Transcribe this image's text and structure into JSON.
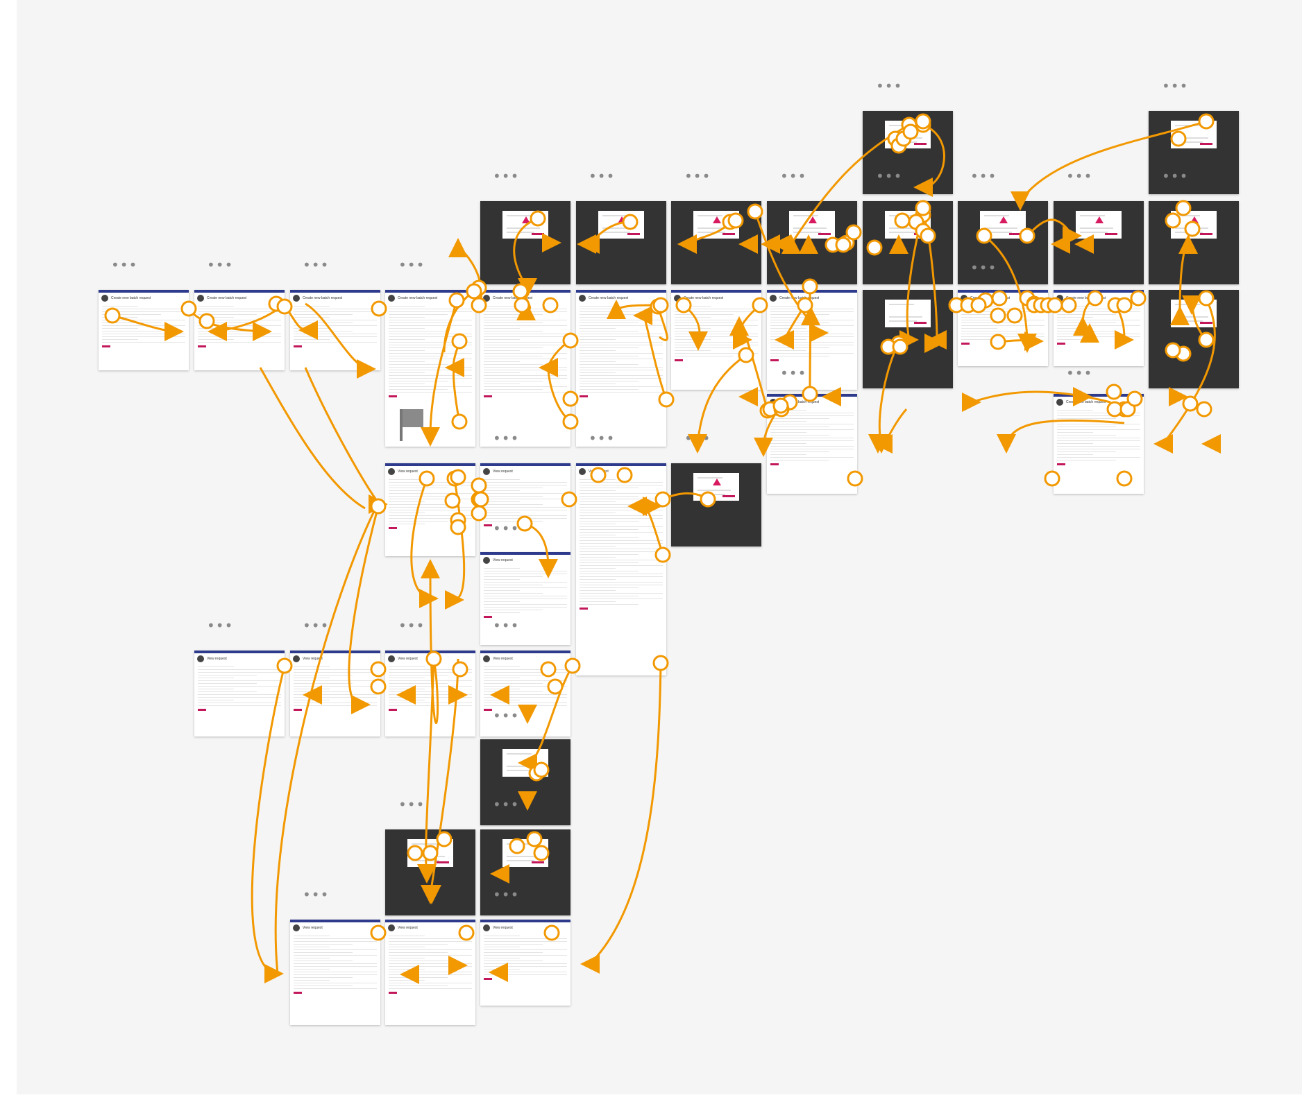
{
  "canvas": {
    "background": "#f5f5f5"
  },
  "colors": {
    "connector": "#f29800",
    "dark_frame": "#333333",
    "light_frame": "#ffffff",
    "brand_bar": "#2e3a8c",
    "accent": "#c2185b"
  },
  "more_menu_label": "•••",
  "frame_titles": {
    "create": "Create new batch request",
    "view": "View request"
  },
  "icons": [
    "more-options-icon",
    "start-flag-icon",
    "connector-arrow-icon",
    "connector-dot-icon"
  ]
}
